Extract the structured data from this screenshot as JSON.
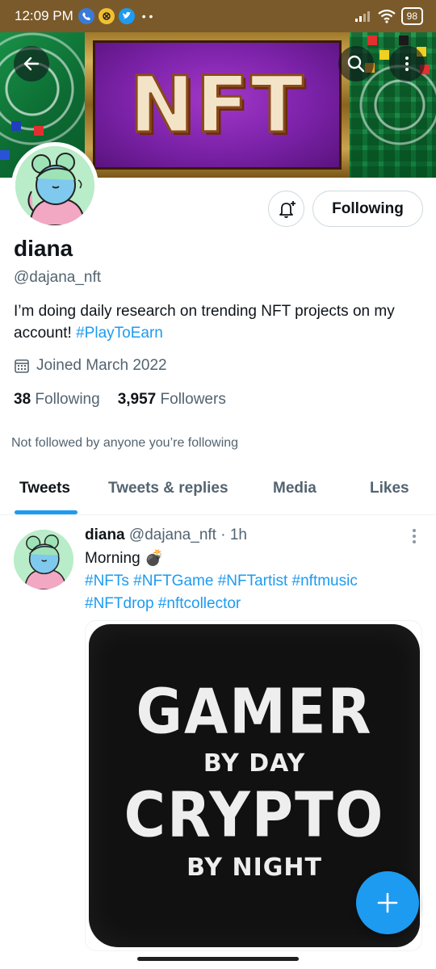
{
  "status_bar": {
    "time": "12:09 PM",
    "battery": "98"
  },
  "banner": {
    "text": "NFT"
  },
  "profile": {
    "name": "diana",
    "handle": "@dajana_nft",
    "bio_text": "I’m doing daily research on trending NFT projects on my account!",
    "bio_hashtag": "#PlayToEarn",
    "joined": "Joined March 2022",
    "following_count": "38",
    "following_label": "Following",
    "followers_count": "3,957",
    "followers_label": "Followers",
    "not_followed_text": "Not followed by anyone you’re following",
    "follow_button_label": "Following"
  },
  "tabs": [
    {
      "label": "Tweets",
      "active": true
    },
    {
      "label": "Tweets & replies",
      "active": false
    },
    {
      "label": "Media",
      "active": false
    },
    {
      "label": "Likes",
      "active": false
    }
  ],
  "tweet": {
    "name": "diana",
    "handle": "@dajana_nft",
    "separator": "·",
    "time": "1h",
    "text": "Morning",
    "emoji": "💣",
    "hashtags_line1": "#NFTs #NFTGame #NFTartist #nftmusic",
    "hashtags_line2": "#NFTdrop #nftcollector",
    "image_text": {
      "line1": "GAMER",
      "line2": "BY DAY",
      "line3": "CRYPTO",
      "line4": "BY NIGHT"
    }
  },
  "icons": {
    "back": "back-arrow-icon",
    "search": "search-icon",
    "more": "more-vertical-icon",
    "bell": "notification-bell-add-icon",
    "calendar": "calendar-icon",
    "compose": "compose-plus-icon"
  },
  "colors": {
    "accent": "#1d9bf0",
    "text_primary": "#0f1419",
    "text_secondary": "#536471"
  }
}
